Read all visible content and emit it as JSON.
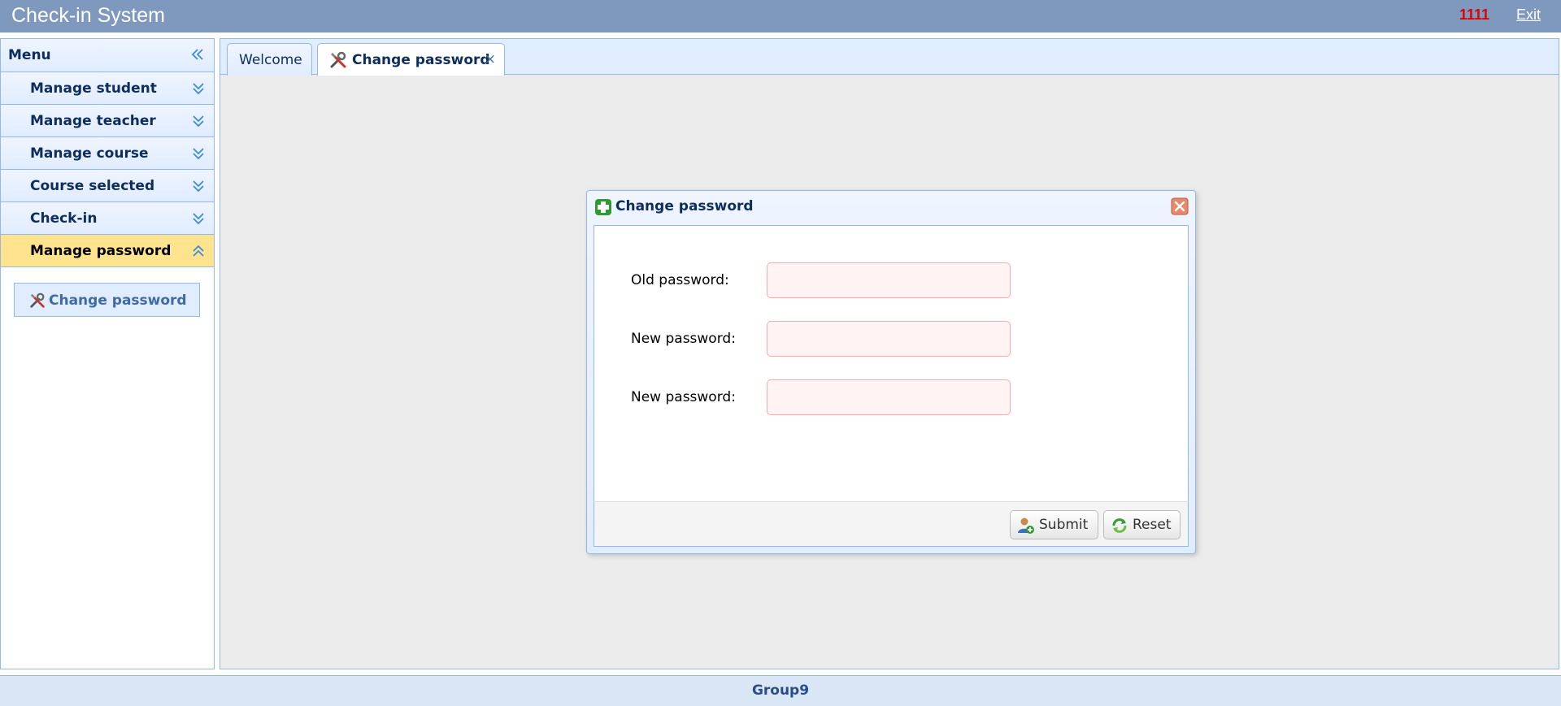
{
  "header": {
    "title": "Check-in System",
    "user_id": "1111",
    "exit_label": "Exit"
  },
  "sidebar": {
    "menu_label": "Menu",
    "items": [
      {
        "label": "Manage student"
      },
      {
        "label": "Manage teacher"
      },
      {
        "label": "Manage course"
      },
      {
        "label": "Course selected"
      },
      {
        "label": "Check-in"
      },
      {
        "label": "Manage password"
      }
    ],
    "active_item": "Manage password",
    "sub_link": {
      "label": "Change password",
      "icon": "tools-icon"
    }
  },
  "tabs": {
    "welcome_label": "Welcome",
    "change_password_label": "Change password",
    "close_glyph": "×"
  },
  "dialog": {
    "title": "Change password",
    "fields": [
      {
        "label": "Old password:",
        "value": "",
        "placeholder": ""
      },
      {
        "label": "New password:",
        "value": "",
        "placeholder": ""
      },
      {
        "label": "New password:",
        "value": "",
        "placeholder": ""
      }
    ],
    "submit_label": "Submit",
    "reset_label": "Reset"
  },
  "footer": {
    "label": "Group9"
  },
  "colors": {
    "header_bg": "#7f99be",
    "panel_border": "#95b8e7",
    "active_item_bg": "#ffe48d",
    "user_id_color": "#e00000",
    "input_invalid_bg": "#fff3f3"
  }
}
